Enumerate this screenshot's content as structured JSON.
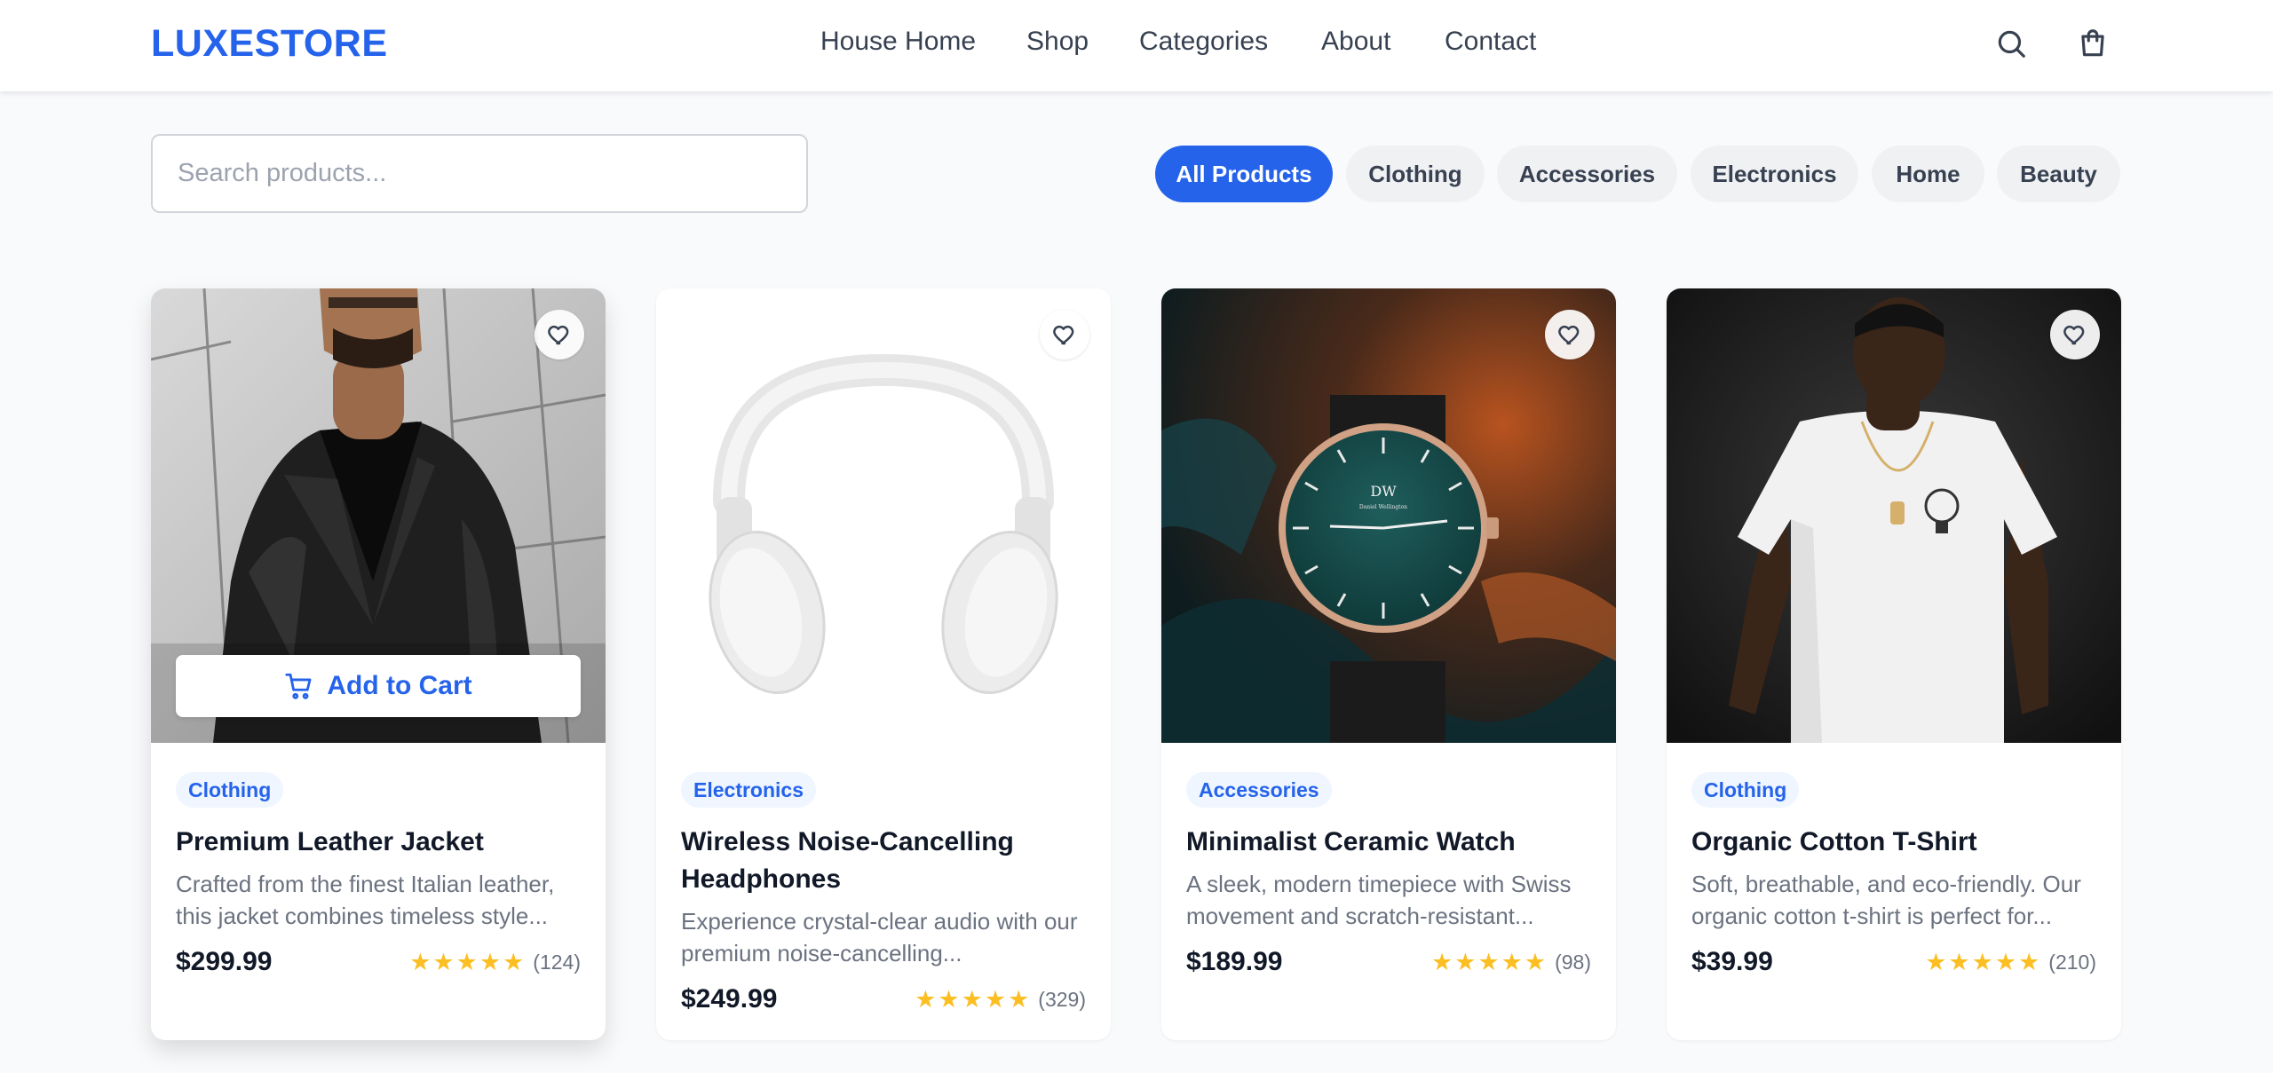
{
  "header": {
    "logo": "LUXESTORE",
    "nav": [
      "House Home",
      "Shop",
      "Categories",
      "About",
      "Contact"
    ],
    "icons": [
      "search-icon",
      "shopping-bag-icon"
    ]
  },
  "search": {
    "placeholder": "Search products..."
  },
  "filters": {
    "chips": [
      "All Products",
      "Clothing",
      "Accessories",
      "Electronics",
      "Home",
      "Beauty"
    ],
    "active": "All Products"
  },
  "colors": {
    "accent": "#2563eb",
    "star": "#fbbf24",
    "text_primary": "#111827",
    "text_muted": "#6b7280",
    "background": "#f9fafb"
  },
  "products": [
    {
      "category": "Clothing",
      "name": "Premium Leather Jacket",
      "description": "Crafted from the finest Italian leather, this jacket combines timeless style...",
      "price": "$299.99",
      "rating": 5,
      "review_count": "(124)",
      "add_to_cart": "Add to Cart"
    },
    {
      "category": "Electronics",
      "name": "Wireless Noise-Cancelling Headphones",
      "description": "Experience crystal-clear audio with our premium noise-cancelling...",
      "price": "$249.99",
      "rating": 5,
      "review_count": "(329)"
    },
    {
      "category": "Accessories",
      "name": "Minimalist Ceramic Watch",
      "description": "A sleek, modern timepiece with Swiss movement and scratch-resistant...",
      "price": "$189.99",
      "rating": 5,
      "review_count": "(98)",
      "watch_brand_mark": "DW",
      "watch_brand_text": "Daniel Wellington"
    },
    {
      "category": "Clothing",
      "name": "Organic Cotton T-Shirt",
      "description": "Soft, breathable, and eco-friendly. Our organic cotton t-shirt is perfect for...",
      "price": "$39.99",
      "rating": 5,
      "review_count": "(210)"
    }
  ]
}
